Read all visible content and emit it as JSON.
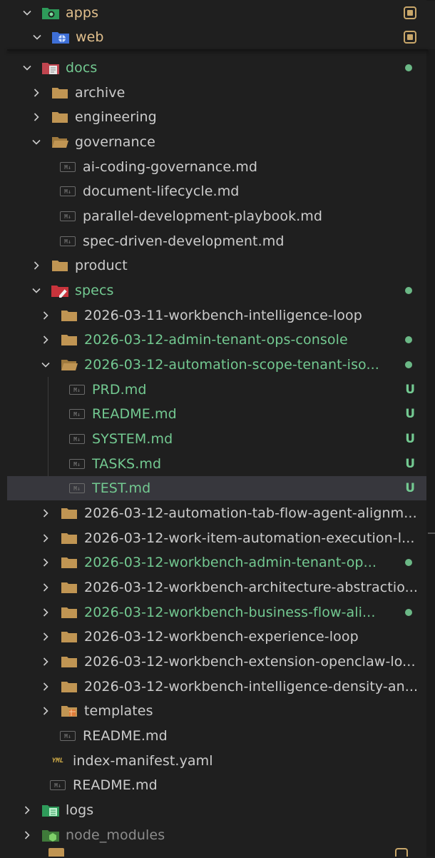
{
  "explorer": {
    "rows": [
      {
        "label": "apps",
        "color": "orange",
        "badge": "square",
        "expanded": true,
        "icon": "apps-folder-icon"
      },
      {
        "label": "web",
        "color": "orange",
        "badge": "square",
        "expanded": true,
        "icon": "web-folder-icon"
      },
      {
        "label": "docs",
        "color": "green",
        "badge": "dot",
        "expanded": true,
        "icon": "docs-folder-icon"
      },
      {
        "label": "archive",
        "color": "normal",
        "expanded": false,
        "icon": "folder-icon"
      },
      {
        "label": "engineering",
        "color": "normal",
        "expanded": false,
        "icon": "folder-icon"
      },
      {
        "label": "governance",
        "color": "normal",
        "expanded": true,
        "icon": "folder-open-icon"
      },
      {
        "label": "ai-coding-governance.md",
        "color": "normal",
        "icon": "markdown-file-icon"
      },
      {
        "label": "document-lifecycle.md",
        "color": "normal",
        "icon": "markdown-file-icon"
      },
      {
        "label": "parallel-development-playbook.md",
        "color": "normal",
        "icon": "markdown-file-icon"
      },
      {
        "label": "spec-driven-development.md",
        "color": "normal",
        "icon": "markdown-file-icon"
      },
      {
        "label": "product",
        "color": "normal",
        "expanded": false,
        "icon": "folder-icon"
      },
      {
        "label": "specs",
        "color": "green",
        "badge": "dot",
        "expanded": true,
        "icon": "specs-folder-icon"
      },
      {
        "label": "2026-03-11-workbench-intelligence-loop",
        "color": "normal",
        "expanded": false,
        "icon": "folder-icon"
      },
      {
        "label": "2026-03-12-admin-tenant-ops-console",
        "color": "green",
        "badge": "dot",
        "expanded": false,
        "icon": "folder-icon"
      },
      {
        "label": "2026-03-12-automation-scope-tenant-iso...",
        "color": "green",
        "badge": "dot",
        "expanded": true,
        "icon": "folder-open-icon"
      },
      {
        "label": "PRD.md",
        "color": "green",
        "badge": "U",
        "icon": "markdown-file-icon"
      },
      {
        "label": "README.md",
        "color": "green",
        "badge": "U",
        "icon": "markdown-file-icon"
      },
      {
        "label": "SYSTEM.md",
        "color": "green",
        "badge": "U",
        "icon": "markdown-file-icon"
      },
      {
        "label": "TASKS.md",
        "color": "green",
        "badge": "U",
        "icon": "markdown-file-icon"
      },
      {
        "label": "TEST.md",
        "color": "green",
        "badge": "U",
        "icon": "markdown-file-icon",
        "selected": true
      },
      {
        "label": "2026-03-12-automation-tab-flow-agent-alignm...",
        "color": "normal",
        "expanded": false,
        "icon": "folder-icon"
      },
      {
        "label": "2026-03-12-work-item-automation-execution-l...",
        "color": "normal",
        "expanded": false,
        "icon": "folder-icon"
      },
      {
        "label": "2026-03-12-workbench-admin-tenant-op...",
        "color": "green",
        "badge": "dot",
        "expanded": false,
        "icon": "folder-icon"
      },
      {
        "label": "2026-03-12-workbench-architecture-abstractio...",
        "color": "normal",
        "expanded": false,
        "icon": "folder-icon"
      },
      {
        "label": "2026-03-12-workbench-business-flow-ali...",
        "color": "green",
        "badge": "dot",
        "expanded": false,
        "icon": "folder-icon"
      },
      {
        "label": "2026-03-12-workbench-experience-loop",
        "color": "normal",
        "expanded": false,
        "icon": "folder-icon"
      },
      {
        "label": "2026-03-12-workbench-extension-openclaw-lo...",
        "color": "normal",
        "expanded": false,
        "icon": "folder-icon"
      },
      {
        "label": "2026-03-12-workbench-intelligence-density-an...",
        "color": "normal",
        "expanded": false,
        "icon": "folder-icon"
      },
      {
        "label": "templates",
        "color": "normal",
        "expanded": false,
        "icon": "templates-folder-icon"
      },
      {
        "label": "README.md",
        "color": "normal",
        "icon": "markdown-file-icon"
      },
      {
        "label": "index-manifest.yaml",
        "color": "normal",
        "icon": "yaml-file-icon"
      },
      {
        "label": "README.md",
        "color": "normal",
        "icon": "markdown-file-icon"
      },
      {
        "label": "logs",
        "color": "normal",
        "expanded": false,
        "icon": "logs-folder-icon"
      },
      {
        "label": "node_modules",
        "color": "dim",
        "expanded": false,
        "icon": "node-modules-folder-icon"
      }
    ],
    "colors": {
      "background": "#1f1f1f",
      "text": "#cccccc",
      "git_added": "#73c991",
      "git_modified": "#e2c08d",
      "folder": "#c09553",
      "selection": "#37373d"
    }
  }
}
